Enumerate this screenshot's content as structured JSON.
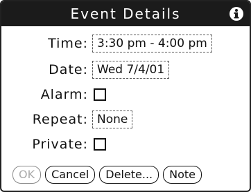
{
  "window": {
    "title": "Event Details",
    "info_icon": "info-icon"
  },
  "fields": {
    "time_label": "Time:",
    "time_value": "3:30 pm - 4:00 pm",
    "date_label": "Date:",
    "date_value": "Wed 7/4/01",
    "alarm_label": "Alarm:",
    "alarm_checked": false,
    "repeat_label": "Repeat:",
    "repeat_value": "None",
    "private_label": "Private:",
    "private_checked": false
  },
  "buttons": {
    "ok_label": "OK",
    "cancel_label": "Cancel",
    "delete_label": "Delete...",
    "note_label": "Note"
  }
}
